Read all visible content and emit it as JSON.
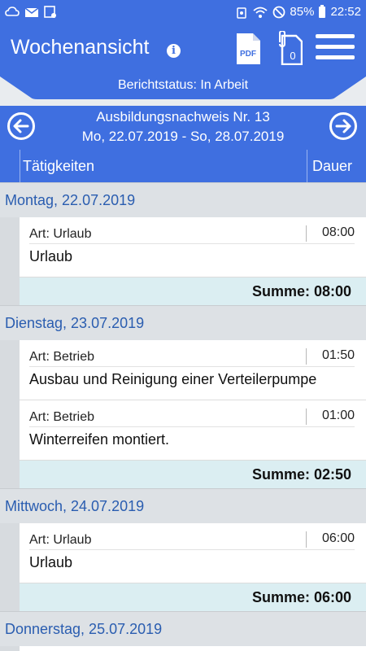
{
  "status_bar": {
    "battery": "85%",
    "time": "22:52"
  },
  "app_bar": {
    "title": "Wochenansicht",
    "attachment_count": "0",
    "pdf_label": "PDF"
  },
  "report_status": "Berichtstatus: In Arbeit",
  "week": {
    "title": "Ausbildungsnachweis Nr. 13",
    "range": "Mo, 22.07.2019 - So, 28.07.2019"
  },
  "columns": {
    "activities": "Tätigkeiten",
    "duration": "Dauer"
  },
  "days": [
    {
      "date": "Montag, 22.07.2019",
      "entries": [
        {
          "type": "Art: Urlaub",
          "duration": "08:00",
          "description": "Urlaub"
        }
      ],
      "sum": "Summe: 08:00"
    },
    {
      "date": "Dienstag, 23.07.2019",
      "entries": [
        {
          "type": "Art: Betrieb",
          "duration": "01:50",
          "description": "Ausbau und Reinigung einer Verteilerpumpe"
        },
        {
          "type": "Art: Betrieb",
          "duration": "01:00",
          "description": "Winterreifen montiert."
        }
      ],
      "sum": "Summe: 02:50"
    },
    {
      "date": "Mittwoch, 24.07.2019",
      "entries": [
        {
          "type": "Art: Urlaub",
          "duration": "06:00",
          "description": "Urlaub"
        }
      ],
      "sum": "Summe: 06:00"
    },
    {
      "date": "Donnerstag, 25.07.2019",
      "entries": [],
      "sum": ""
    }
  ],
  "colors": {
    "primary": "#3f6fe0",
    "day_header": "#dde1e5",
    "sum_row": "#dbeef2",
    "day_text": "#2a5db0"
  }
}
